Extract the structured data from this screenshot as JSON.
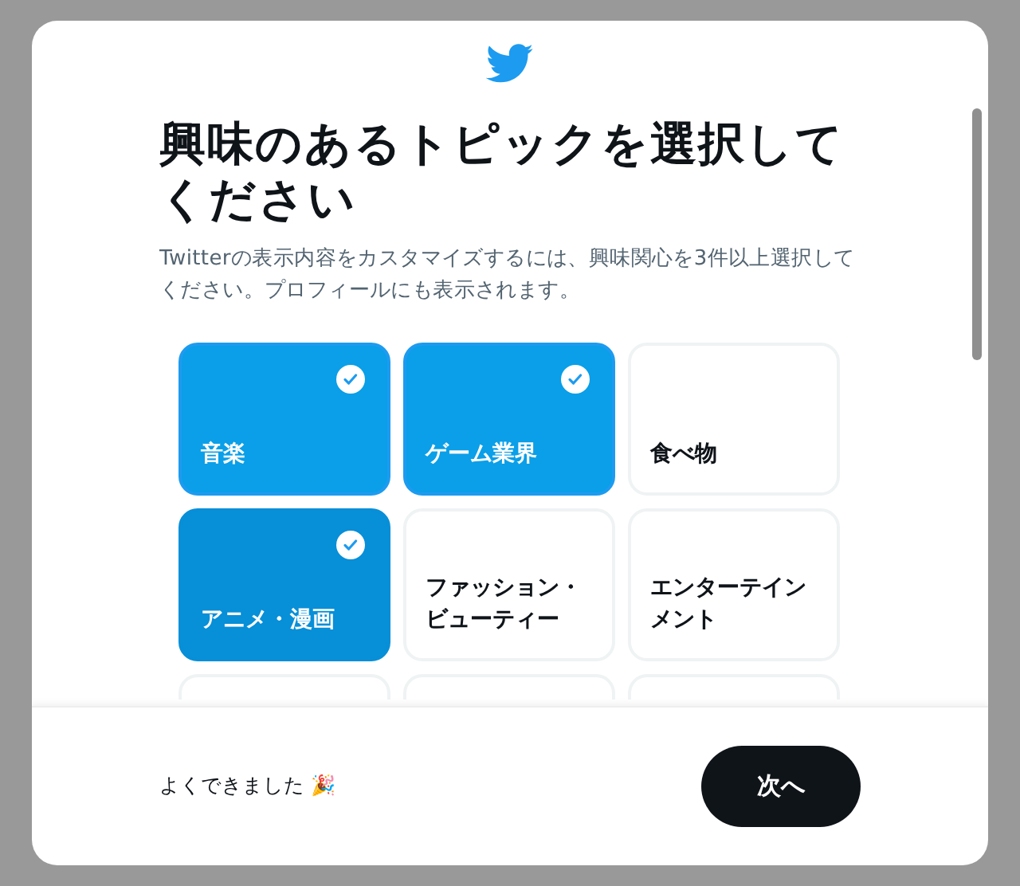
{
  "title": "興味のあるトピックを選択してください",
  "subtitle": "Twitterの表示内容をカスタマイズするには、興味関心を3件以上選択してください。プロフィールにも表示されます。",
  "topics": [
    {
      "kind": "topic",
      "label": "音楽",
      "selected": true,
      "hovered": false
    },
    {
      "kind": "topic",
      "label": "ゲーム業界",
      "selected": true,
      "hovered": false
    },
    {
      "kind": "topic",
      "label": "食べ物",
      "selected": false,
      "hovered": false
    },
    {
      "kind": "topic",
      "label": "アニメ・漫画",
      "selected": true,
      "hovered": true
    },
    {
      "kind": "topic",
      "label": "ファッション・ビューティー",
      "selected": false,
      "hovered": false
    },
    {
      "kind": "topic",
      "label": "エンターテインメント",
      "selected": false,
      "hovered": false
    },
    {
      "kind": "cut"
    },
    {
      "kind": "cut"
    },
    {
      "kind": "cut"
    }
  ],
  "footer": {
    "message": "よくできました 🎉",
    "next_button": "次へ"
  }
}
